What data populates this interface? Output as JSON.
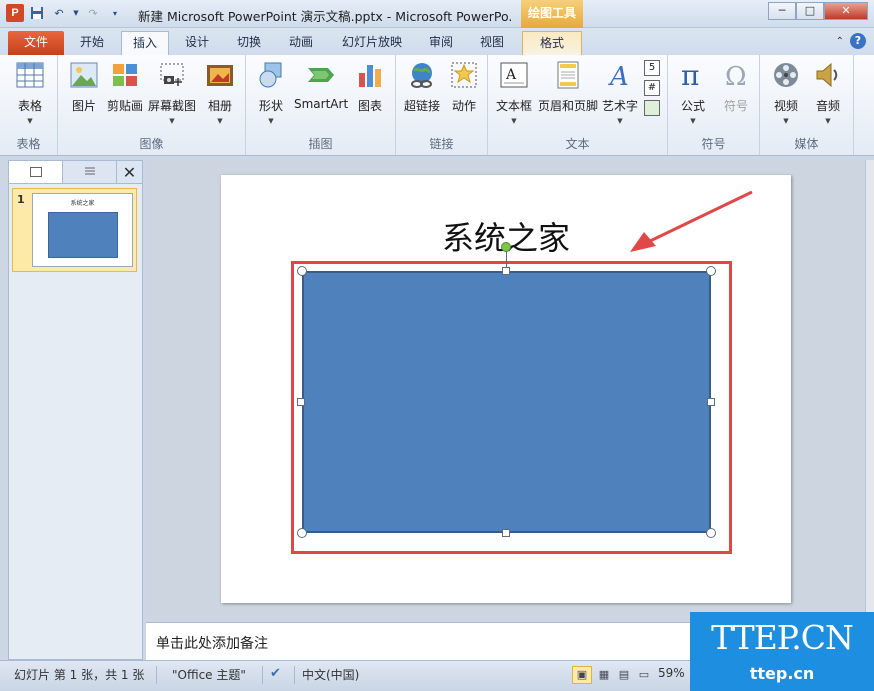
{
  "window": {
    "title": "新建 Microsoft PowerPoint 演示文稿.pptx - Microsoft PowerPo...",
    "context_tab_group": "绘图工具",
    "controls": [
      "─",
      "□",
      "✕"
    ]
  },
  "tabs": [
    {
      "label": "文件"
    },
    {
      "label": "开始"
    },
    {
      "label": "插入"
    },
    {
      "label": "设计"
    },
    {
      "label": "切换"
    },
    {
      "label": "动画"
    },
    {
      "label": "幻灯片放映"
    },
    {
      "label": "审阅"
    },
    {
      "label": "视图"
    },
    {
      "label": "格式"
    }
  ],
  "ribbon": {
    "groups": {
      "table": "表格",
      "image": "图像",
      "illustration": "插图",
      "links": "链接",
      "text": "文本",
      "symbols": "符号",
      "media": "媒体"
    },
    "buttons": {
      "table": "表格",
      "picture": "图片",
      "clipart": "剪贴画",
      "screenshot": "屏幕截图",
      "album": "相册",
      "shapes": "形状",
      "smartart": "SmartArt",
      "chart": "图表",
      "hyperlink": "超链接",
      "action": "动作",
      "textbox": "文本框",
      "header_footer": "页眉和页脚",
      "wordart": "艺术字",
      "equation": "公式",
      "symbol": "符号",
      "video": "视频",
      "audio": "音频"
    }
  },
  "slides_pane": {
    "slide_number": "1",
    "thumb_title": "系统之家"
  },
  "slide": {
    "title": "系统之家"
  },
  "notes": {
    "placeholder": "单击此处添加备注"
  },
  "statusbar": {
    "slide_info": "幻灯片 第 1 张，共 1 张",
    "theme": "\"Office 主题\"",
    "language": "中文(中国)",
    "zoom": "59%"
  },
  "watermark": {
    "big": "TTEP.CN",
    "small": "ttep.cn"
  },
  "colors": {
    "shape_fill": "#4f81bd",
    "highlight_box": "#e04848",
    "file_tab": "#d24726",
    "drawing_tools": "#e7a93a"
  }
}
